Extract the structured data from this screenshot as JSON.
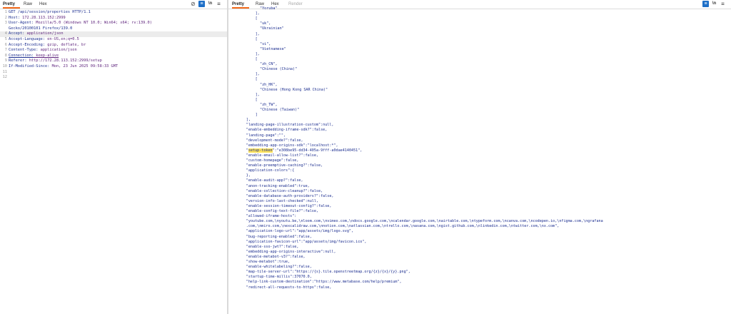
{
  "left": {
    "tabs": [
      "Pretty",
      "Raw",
      "Hex"
    ],
    "lines": [
      {
        "n": "1",
        "key": "GET /api/session/properties HTTP/1.1",
        "val": ""
      },
      {
        "n": "2",
        "key": "Host:",
        "val": " 172.28.113.152:2999"
      },
      {
        "n": "3",
        "key": "User-Agent:",
        "val": " Mozilla/5.0 (Windows NT 10.0; Win64; x64; rv:139.0)"
      },
      {
        "n": "",
        "key": "Gecko/20100101 Firefox/139.0",
        "val": ""
      },
      {
        "n": "4",
        "key": "Accept:",
        "val": " application/json"
      },
      {
        "n": "5",
        "key": "Accept-Language:",
        "val": " en-US,en;q=0.5"
      },
      {
        "n": "6",
        "key": "Accept-Encoding:",
        "val": " gzip, deflate, br"
      },
      {
        "n": "7",
        "key": "Content-Type:",
        "val": " application/json"
      },
      {
        "n": "8",
        "key": "Connection:",
        "val": " keep-alive"
      },
      {
        "n": "9",
        "key": "Referer:",
        "val": " http://172.28.113.152:2999/setup"
      },
      {
        "n": "10",
        "key": "If-Modified-Since:",
        "val": " Mon, 23 Jun 2025 09:58:33 GMT"
      },
      {
        "n": "11",
        "key": "",
        "val": ""
      },
      {
        "n": "12",
        "key": "",
        "val": ""
      }
    ]
  },
  "right": {
    "tabs": [
      "Pretty",
      "Raw",
      "Hex",
      "Render"
    ],
    "lines": [
      {
        "i": 5,
        "t": "\"Yoruba\""
      },
      {
        "i": 4,
        "t": "],"
      },
      {
        "i": 4,
        "t": "["
      },
      {
        "i": 5,
        "t": "\"uk\","
      },
      {
        "i": 5,
        "t": "\"Ukrainian\""
      },
      {
        "i": 4,
        "t": "],"
      },
      {
        "i": 4,
        "t": "["
      },
      {
        "i": 5,
        "t": "\"vi\","
      },
      {
        "i": 5,
        "t": "\"Vietnamese\""
      },
      {
        "i": 4,
        "t": "],"
      },
      {
        "i": 4,
        "t": "["
      },
      {
        "i": 5,
        "t": "\"zh_CN\","
      },
      {
        "i": 5,
        "t": "\"Chinese (China)\""
      },
      {
        "i": 4,
        "t": "],"
      },
      {
        "i": 4,
        "t": "["
      },
      {
        "i": 5,
        "t": "\"zh_HK\","
      },
      {
        "i": 5,
        "t": "\"Chinese (Hong Kong SAR China)\""
      },
      {
        "i": 4,
        "t": "],"
      },
      {
        "i": 4,
        "t": "["
      },
      {
        "i": 5,
        "t": "\"zh_TW\","
      },
      {
        "i": 5,
        "t": "\"Chinese (Taiwan)\""
      },
      {
        "i": 4,
        "t": "]"
      },
      {
        "i": 2,
        "t": "],"
      },
      {
        "i": 2,
        "t": "\"landing-page-illustration-custom\":null,"
      },
      {
        "i": 2,
        "t": "\"enable-embedding-iframe-sdk?\":false,"
      },
      {
        "i": 2,
        "t": "\"landing-page\":\"\","
      },
      {
        "i": 2,
        "t": "\"development-mode?\":false,"
      },
      {
        "i": 2,
        "t": "\"embedding-app-origins-sdk\":\"localhost:*\","
      },
      {
        "i": 2,
        "t": "\"setup-token\":\"e308be95-dd34-405a-9fff-a0dae4140451\",",
        "mark": "setup-token"
      },
      {
        "i": 2,
        "t": "\"enable-email-allow-list?\":false,"
      },
      {
        "i": 2,
        "t": "\"custom-homepage\":false,"
      },
      {
        "i": 2,
        "t": "\"enable-preemptive-caching?\":false,"
      },
      {
        "i": 2,
        "t": "\"application-colors\":{"
      },
      {
        "i": 2,
        "t": "},"
      },
      {
        "i": 2,
        "t": "\"enable-audit-app?\":false,"
      },
      {
        "i": 2,
        "t": "\"anon-tracking-enabled\":true,"
      },
      {
        "i": 2,
        "t": "\"enable-collection-cleanup?\":false,"
      },
      {
        "i": 2,
        "t": "\"enable-database-auth-providers?\":false,"
      },
      {
        "i": 2,
        "t": "\"version-info-last-checked\":null,"
      },
      {
        "i": 2,
        "t": "\"enable-session-timeout-config?\":false,"
      },
      {
        "i": 2,
        "t": "\"enable-config-text-file?\":false,"
      },
      {
        "i": 2,
        "t": "\"allowed-iframe-hosts\":"
      },
      {
        "i": 2,
        "t": "\"youtube.com,\\nyoutu.be,\\nloom.com,\\nvimeo.com,\\ndocs.google.com,\\ncalendar.google.com,\\nairtable.com,\\ntypeform.com,\\ncanva.com,\\ncodepen.io,\\nfigma.com,\\ngrafana"
      },
      {
        "i": 2,
        "t": ".com,\\nmiro.com,\\nexcalidraw.com,\\nnotion.com,\\natlassian.com,\\ntrello.com,\\nasana.com,\\ngist.github.com,\\nlinkedin.com,\\ntwitter.com,\\nx.com\","
      },
      {
        "i": 2,
        "t": "\"application-logo-url\":\"app/assets/img/logo.svg\","
      },
      {
        "i": 2,
        "t": "\"bug-reporting-enabled\":false,"
      },
      {
        "i": 2,
        "t": "\"application-favicon-url\":\"app/assets/img/favicon.ico\","
      },
      {
        "i": 2,
        "t": "\"enable-sso-jwt?\":false,"
      },
      {
        "i": 2,
        "t": "\"embedding-app-origins-interactive\":null,"
      },
      {
        "i": 2,
        "t": "\"enable-metabot-v3?\":false,"
      },
      {
        "i": 2,
        "t": "\"show-metabot\":true,"
      },
      {
        "i": 2,
        "t": "\"enable-whitelabeling?\":false,"
      },
      {
        "i": 2,
        "t": "\"map-tile-server-url\":\"https://{s}.tile.openstreetmap.org/{z}/{x}/{y}.png\","
      },
      {
        "i": 2,
        "t": "\"startup-time-millis\":37070.0,"
      },
      {
        "i": 2,
        "t": "\"help-link-custom-destination\":\"https://www.metabase.com/help/premium\","
      },
      {
        "i": 2,
        "t": "\"redirect-all-requests-to-https\":false,"
      }
    ]
  },
  "icons": [
    "no-whitespace-icon",
    "pretty-print-icon",
    "newline-icon",
    "menu-icon"
  ],
  "colors": {
    "accent": "#f26a1b",
    "highlight": "#ffe45c",
    "key": "#1b2d8f"
  }
}
